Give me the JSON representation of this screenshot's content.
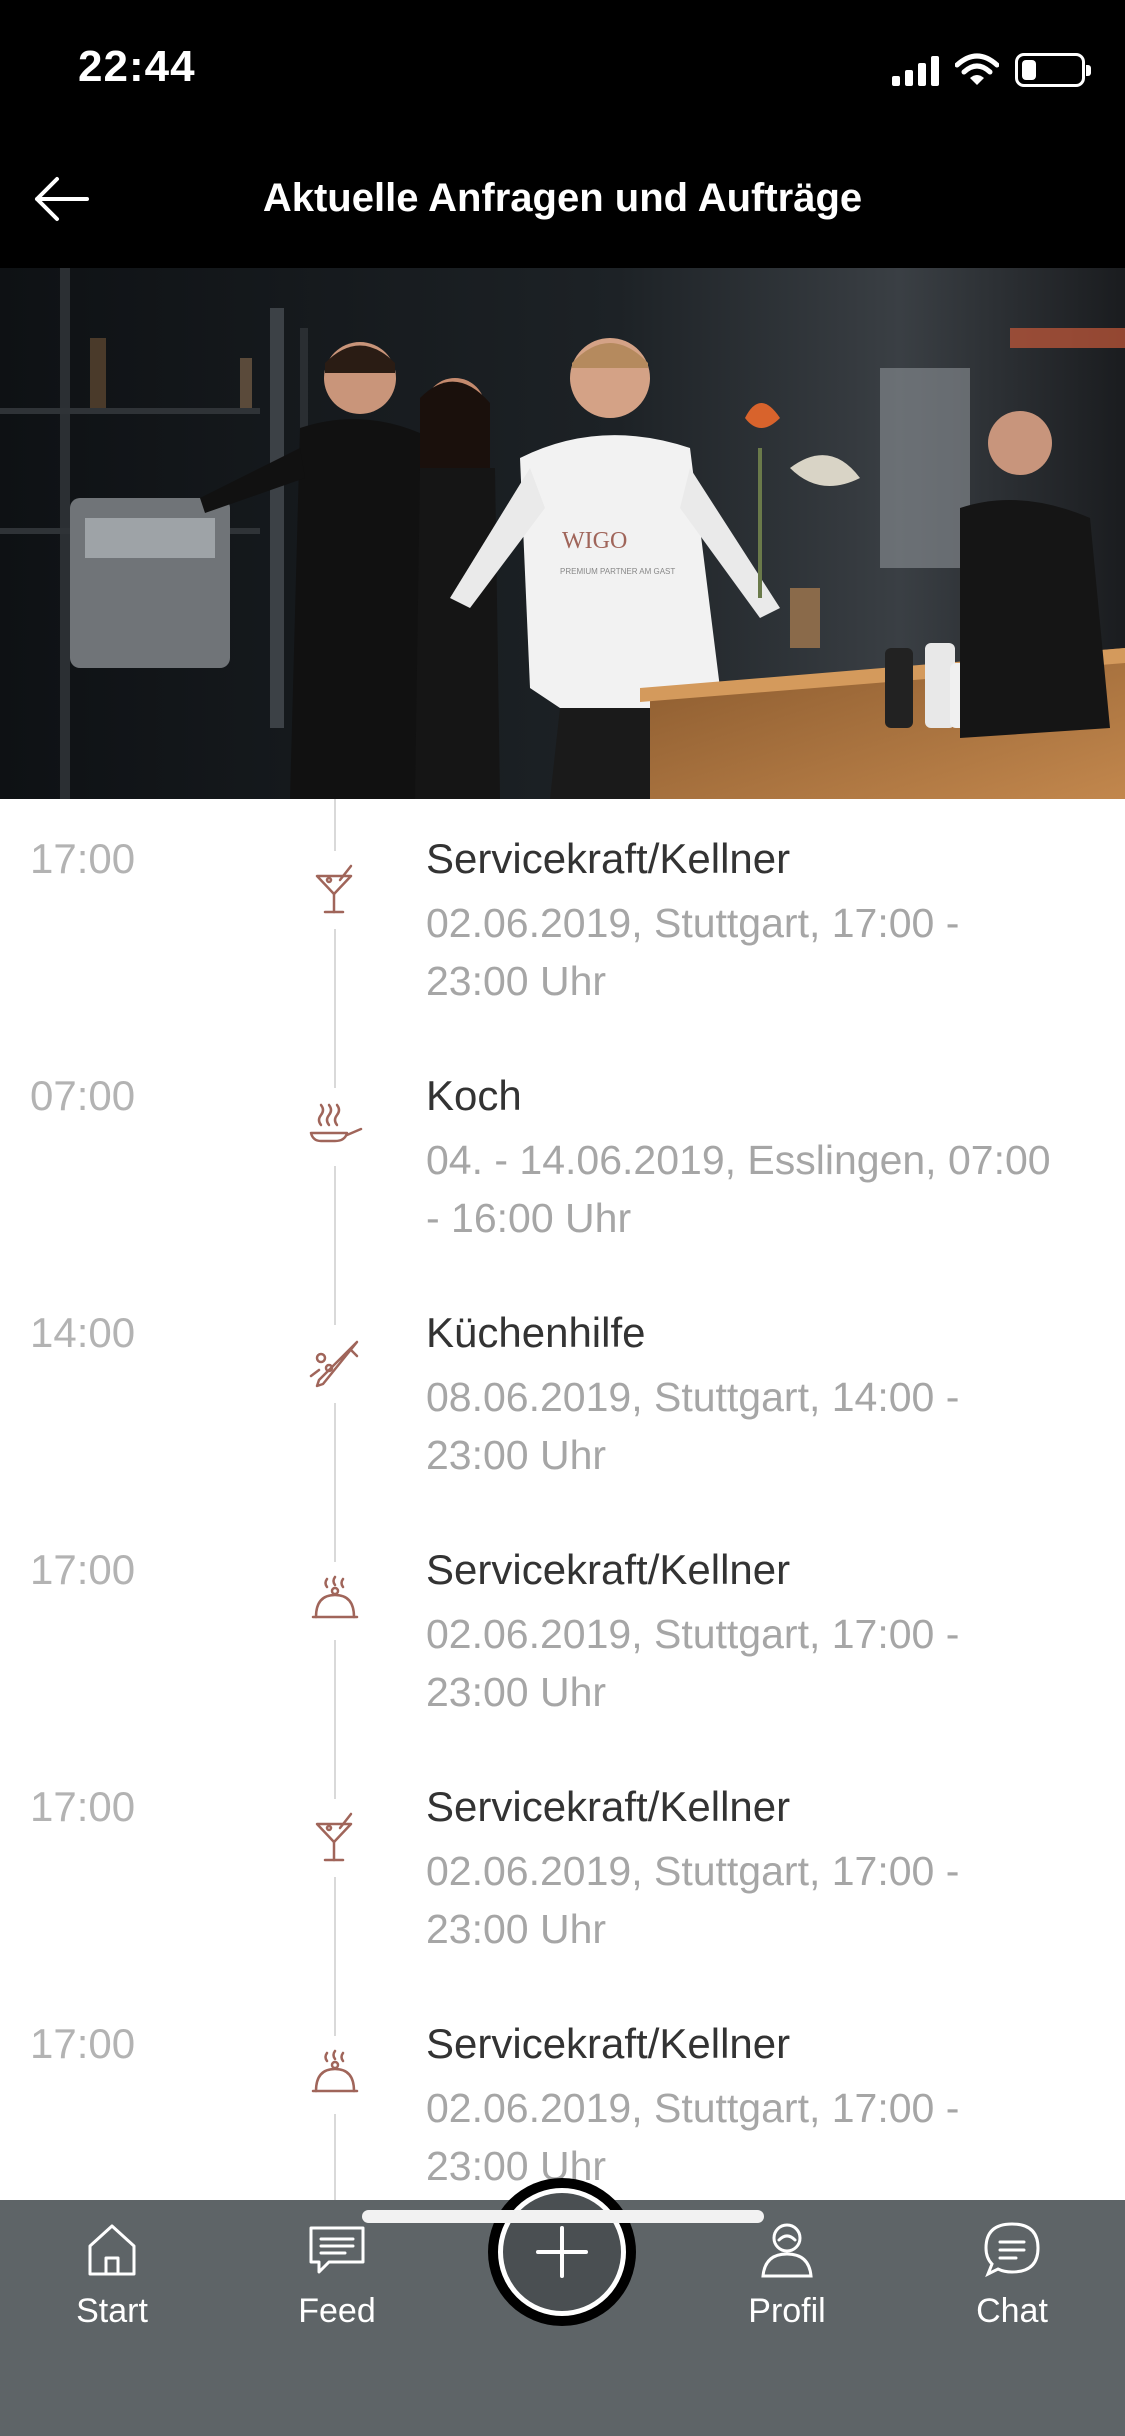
{
  "status_bar": {
    "time": "22:44",
    "battery_level": 0.25
  },
  "header": {
    "title": "Aktuelle Anfragen und Aufträge",
    "back_icon": "arrow-left-icon"
  },
  "hero": {
    "logo_text": "WIGO",
    "logo_subtitle": "PREMIUM PARTNER AM GAST"
  },
  "timeline": {
    "items": [
      {
        "time": "17:00",
        "icon": "cocktail-glass-icon",
        "title": "Servicekraft/Kellner",
        "details": "02.06.2019, Stuttgart, 17:00 - 23:00 Uhr"
      },
      {
        "time": "07:00",
        "icon": "cooking-pan-icon",
        "title": "Koch",
        "details": "04. - 14.06.2019, Esslingen, 07:00 - 16:00 Uhr"
      },
      {
        "time": "14:00",
        "icon": "knife-vegetables-icon",
        "title": "Küchenhilfe",
        "details": "08.06.2019, Stuttgart, 14:00 - 23:00 Uhr"
      },
      {
        "time": "17:00",
        "icon": "serving-cloche-icon",
        "title": "Servicekraft/Kellner",
        "details": "02.06.2019, Stuttgart, 17:00 - 23:00 Uhr"
      },
      {
        "time": "17:00",
        "icon": "cocktail-glass-icon",
        "title": "Servicekraft/Kellner",
        "details": "02.06.2019, Stuttgart, 17:00 - 23:00 Uhr"
      },
      {
        "time": "17:00",
        "icon": "serving-cloche-icon",
        "title": "Servicekraft/Kellner",
        "details": "02.06.2019, Stuttgart, 17:00 - 23:00 Uhr"
      }
    ]
  },
  "tab_bar": {
    "start_label": "Start",
    "feed_label": "Feed",
    "profil_label": "Profil",
    "chat_label": "Chat"
  },
  "colors": {
    "accent_icon": "#a0655a",
    "tab_bar_bg": "#5e6467",
    "header_bg": "#000000"
  }
}
